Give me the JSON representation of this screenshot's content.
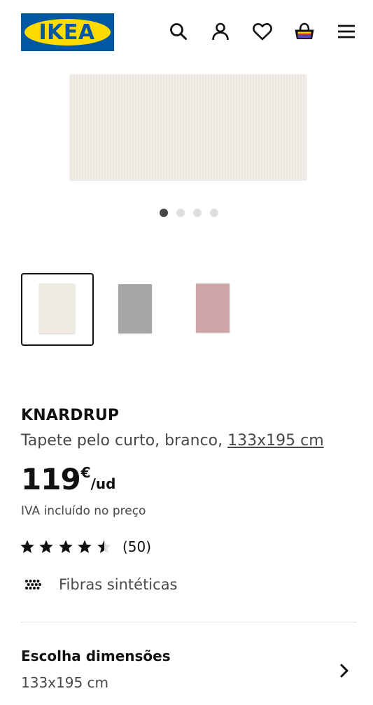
{
  "header": {
    "logo_text": "IKEA",
    "icons": [
      "search-icon",
      "account-icon",
      "heart-icon",
      "basket-icon",
      "menu-icon"
    ]
  },
  "gallery": {
    "main_image": "White short pile rug",
    "dots_total": 4,
    "dots_active": 1,
    "thumbnails": [
      {
        "name": "white",
        "color": "#efeae3"
      },
      {
        "name": "grey",
        "color": "#a5a5a5"
      },
      {
        "name": "pink",
        "color": "#cfa4a6"
      }
    ]
  },
  "product": {
    "name": "KNARDRUP",
    "description": "Tapete pelo curto, branco, ",
    "dimension_link": "133x195 cm",
    "price_integer": "119",
    "currency": "€",
    "unit": "/ud",
    "vat_note": "IVA incluído no preço",
    "rating_value": 4.5,
    "rating_max": 5,
    "rating_count": "(50)",
    "feature_label": "Fibras sintéticas"
  },
  "dimensions": {
    "title": "Escolha dimensões",
    "value": "133x195 cm"
  },
  "colors": {
    "ikea_blue": "#0058a3",
    "ikea_yellow": "#ffdb00",
    "text_primary": "#111111",
    "text_secondary": "#484848"
  }
}
